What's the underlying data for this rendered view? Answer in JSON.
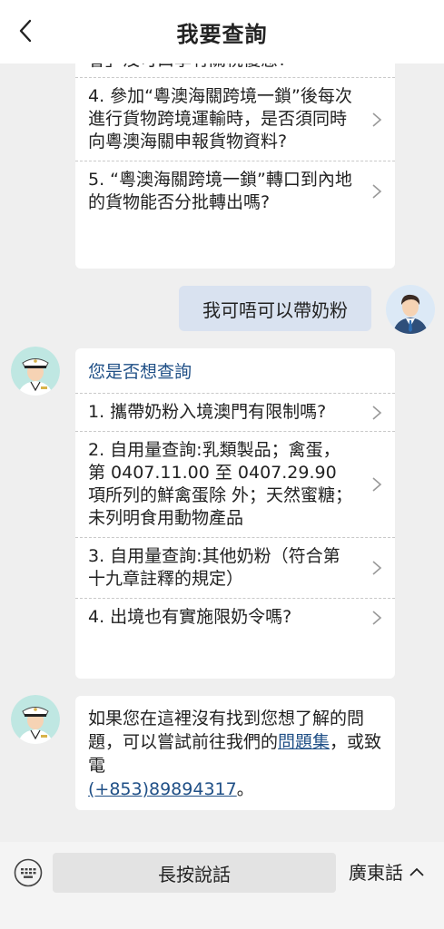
{
  "header": {
    "title": "我要查詢",
    "back_icon": "chevron-left-icon"
  },
  "first_card": {
    "partial_text": "會」沒可口享有關稅優惠?",
    "items": [
      {
        "label": "4. 參加“粵澳海關跨境一鎖”後每次進行貨物跨境運輸時，是否須同時向粵澳海關申報貨物資料?"
      },
      {
        "label": "5. “粵澳海關跨境一鎖”轉口到內地的貨物能否分批轉出嗎?"
      }
    ]
  },
  "user_message": "我可唔可以帶奶粉",
  "suggest_card": {
    "title": "您是否想查詢",
    "items": [
      {
        "label": "1. 攜帶奶粉入境澳門有限制嗎?"
      },
      {
        "label": "2. 自用量查詢:乳類製品；禽蛋，第 0407.11.00 至 0407.29.90 項所列的鮮禽蛋除 外；天然蜜糖；未列明食用動物產品"
      },
      {
        "label": "3. 自用量查詢:其他奶粉（符合第十九章註釋的規定）"
      },
      {
        "label": "4. 出境也有實施限奶令嗎?"
      }
    ]
  },
  "info_card": {
    "text_before": "如果您在這裡沒有找到您想了解的問題，可以嘗試前往我們的",
    "link1": "問題集",
    "text_middle": "，或致電",
    "link2": "(+853)89894317",
    "text_after": "。"
  },
  "bottom_bar": {
    "keyboard_icon": "keyboard-icon",
    "hold_to_speak": "長按說話",
    "language": "廣東話",
    "language_icon": "chevron-up-icon"
  },
  "colors": {
    "accent": "#1f4f86",
    "user_bubble": "#d9e2f0",
    "background": "#efefef"
  }
}
